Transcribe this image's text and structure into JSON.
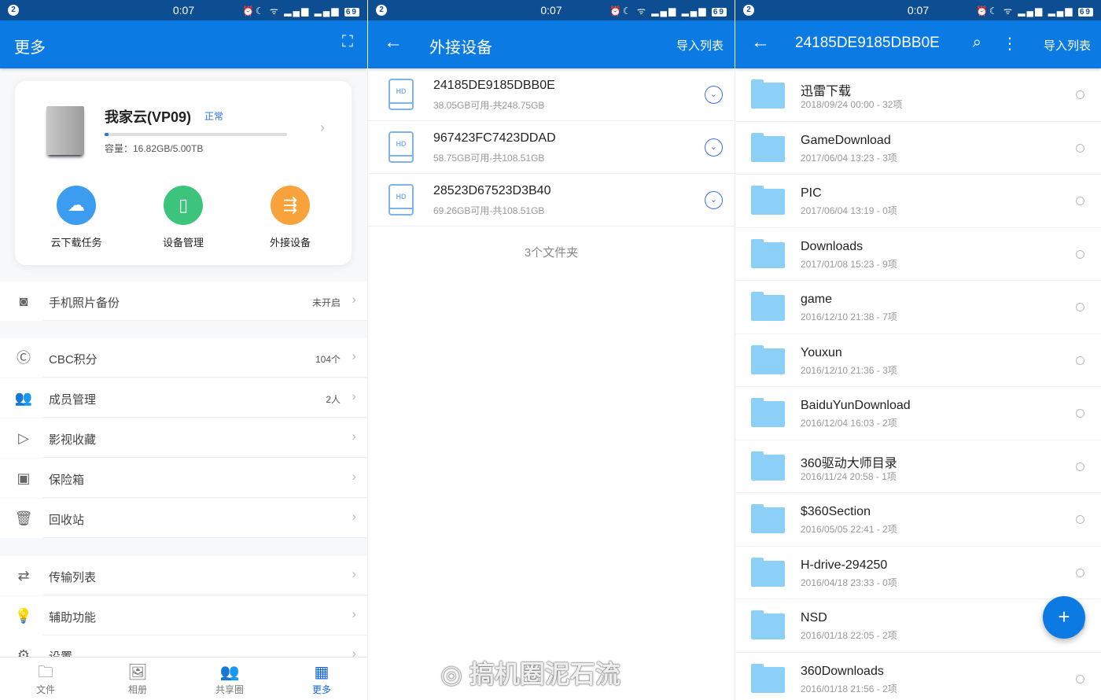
{
  "status": {
    "notif": "2",
    "time": "0:07",
    "icons": "⏰☾ ᯤ ▂▄▆ ▂▄▆",
    "battery": "69"
  },
  "colors": {
    "primary": "#0b7be3",
    "status": "#0d4d91"
  },
  "p1": {
    "title": "更多",
    "device": {
      "name": "我家云(VP09)",
      "status": "正常",
      "capacity": "容量：16.82GB/5.00TB",
      "used_fraction": 0.0033
    },
    "quick": [
      {
        "label": "云下载任务",
        "icon": "cloud-download",
        "color": "#3b9cf0"
      },
      {
        "label": "设备管理",
        "icon": "device",
        "color": "#3cc47c"
      },
      {
        "label": "外接设备",
        "icon": "usb",
        "color": "#f7a23a"
      }
    ],
    "menu": [
      {
        "label": "手机照片备份",
        "value": "未开启",
        "icon": "camera"
      },
      {
        "label": "CBC积分",
        "value": "104个",
        "icon": "cbc"
      },
      {
        "label": "成员管理",
        "value": "2人",
        "icon": "members"
      },
      {
        "label": "影视收藏",
        "value": "",
        "icon": "video"
      },
      {
        "label": "保险箱",
        "value": "",
        "icon": "safe"
      },
      {
        "label": "回收站",
        "value": "",
        "icon": "trash"
      },
      {
        "label": "传输列表",
        "value": "",
        "icon": "transfer"
      },
      {
        "label": "辅助功能",
        "value": "",
        "icon": "bulb"
      },
      {
        "label": "设置",
        "value": "",
        "icon": "settings"
      }
    ],
    "nav": [
      {
        "label": "文件"
      },
      {
        "label": "相册"
      },
      {
        "label": "共享圈"
      },
      {
        "label": "更多"
      }
    ]
  },
  "p2": {
    "title": "外接设备",
    "action": "导入列表",
    "drives": [
      {
        "name": "24185DE9185DBB0E",
        "info": "38.05GB可用-共248.75GB"
      },
      {
        "name": "967423FC7423DDAD",
        "info": "58.75GB可用-共108.51GB"
      },
      {
        "name": "28523D67523D3B40",
        "info": "69.26GB可用-共108.51GB"
      }
    ],
    "count": "3个文件夹",
    "hd": "HD"
  },
  "p3": {
    "title": "24185DE9185DBB0E",
    "action": "导入列表",
    "folders": [
      {
        "name": "迅雷下载",
        "info": "2018/09/24 00:00 - 32项"
      },
      {
        "name": "GameDownload",
        "info": "2017/06/04 13:23 - 3项"
      },
      {
        "name": "PIC",
        "info": "2017/06/04 13:19 - 0项"
      },
      {
        "name": "Downloads",
        "info": "2017/01/08 15:23 - 9项"
      },
      {
        "name": "game",
        "info": "2016/12/10 21:38 - 7项"
      },
      {
        "name": "Youxun",
        "info": "2016/12/10 21:36 - 3项"
      },
      {
        "name": "BaiduYunDownload",
        "info": "2016/12/04 16:03 - 2项"
      },
      {
        "name": "360驱动大师目录",
        "info": "2016/11/24 20:58 - 1项"
      },
      {
        "name": "$360Section",
        "info": "2016/05/05 22:41 - 2项"
      },
      {
        "name": "H-drive-294250",
        "info": "2016/04/18 23:33 - 0项"
      },
      {
        "name": "NSD",
        "info": "2016/01/18 22:05 - 2项"
      },
      {
        "name": "360Downloads",
        "info": "2016/01/18 21:56 - 2项"
      }
    ]
  },
  "watermark": "搞机圈泥石流"
}
